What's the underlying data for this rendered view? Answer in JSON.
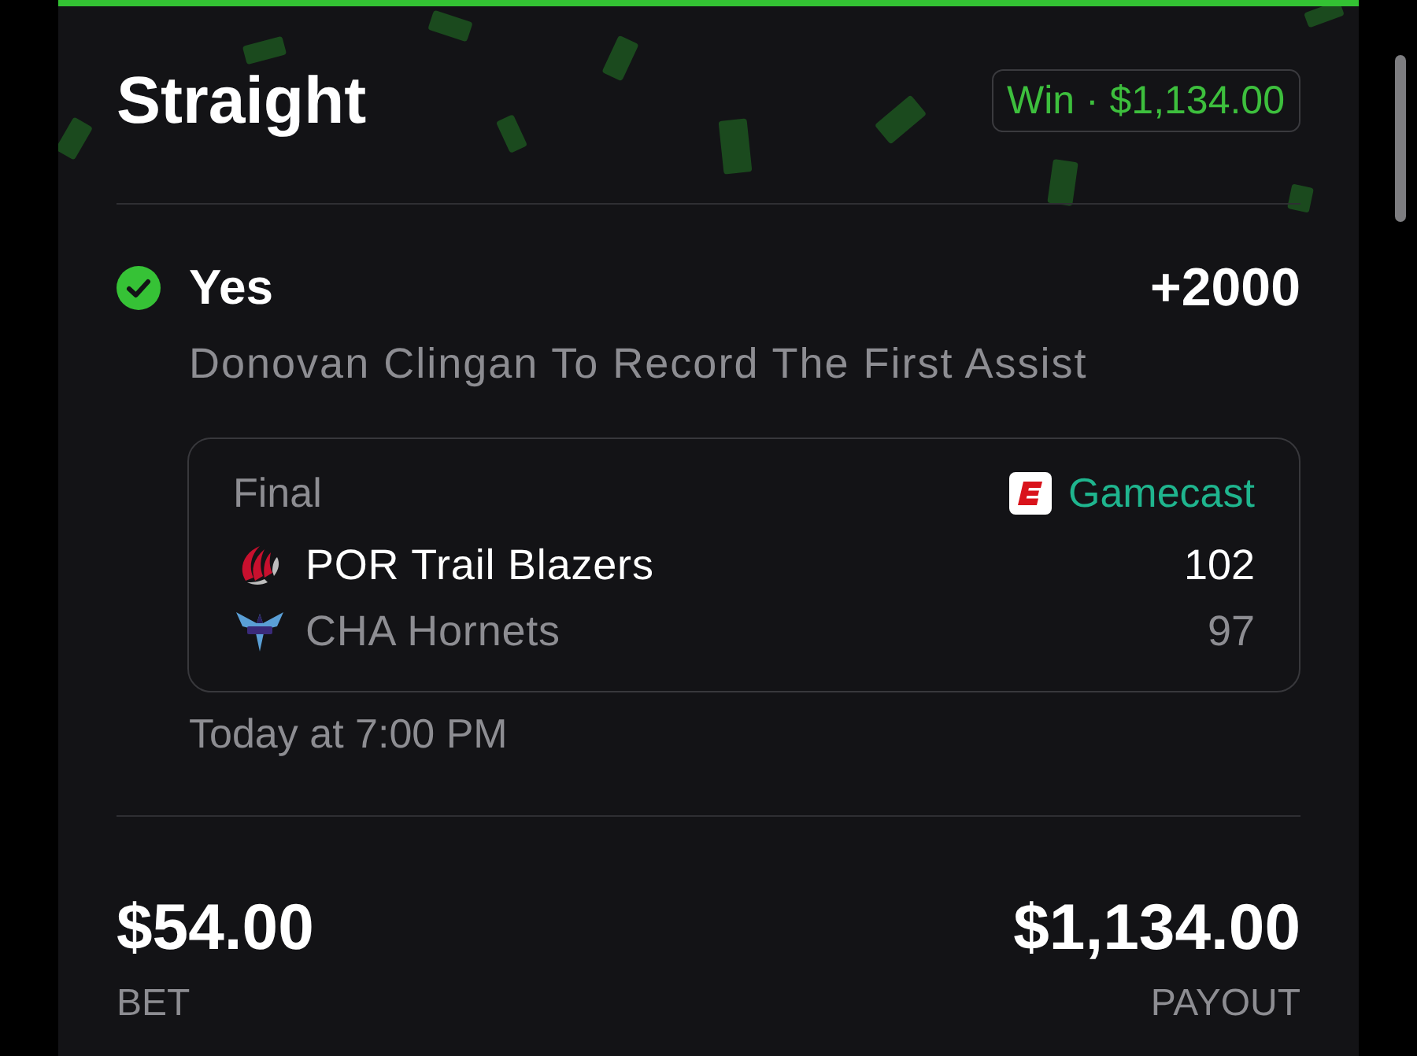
{
  "header": {
    "title": "Straight",
    "badge": "Win · $1,134.00"
  },
  "selection": {
    "won": true,
    "pick": "Yes",
    "odds": "+2000",
    "market": "Donovan Clingan To Record The First Assist"
  },
  "game": {
    "status": "Final",
    "link": "Gamecast",
    "teams": [
      {
        "kind": "pinwheel",
        "name": "POR Trail Blazers",
        "score": "102",
        "winner": true
      },
      {
        "kind": "hornet",
        "name": "CHA Hornets",
        "score": "97",
        "winner": false
      }
    ]
  },
  "time": "Today at 7:00 PM",
  "totals": [
    {
      "amount": "$54.00",
      "label": "BET"
    },
    {
      "amount": "$1,134.00",
      "label": "PAYOUT"
    }
  ]
}
